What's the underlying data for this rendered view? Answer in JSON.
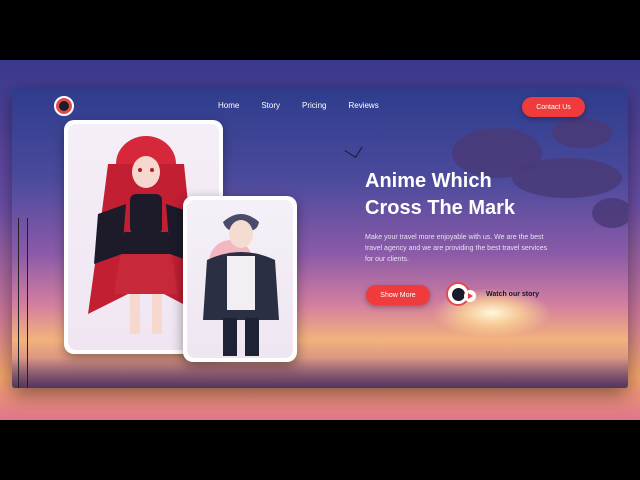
{
  "nav": {
    "items": [
      {
        "label": "Home"
      },
      {
        "label": "Story"
      },
      {
        "label": "Pricing"
      },
      {
        "label": "Reviews"
      }
    ],
    "contact_label": "Contact Us"
  },
  "hero": {
    "title_line1": "Anime Which",
    "title_line2": "Cross The Mark",
    "description": "Make your travel more enjoyable with us. We are the best travel agency and we are providing the best travel services for our clients.",
    "show_more_label": "Show More",
    "watch_label": "Watch our story"
  },
  "colors": {
    "accent": "#ef3b3b",
    "text_light": "#ffffff",
    "text_dark": "#1a1633"
  },
  "icons": {
    "logo": "anime-avatar-logo",
    "play": "play-icon",
    "bird": "bird-silhouette"
  }
}
